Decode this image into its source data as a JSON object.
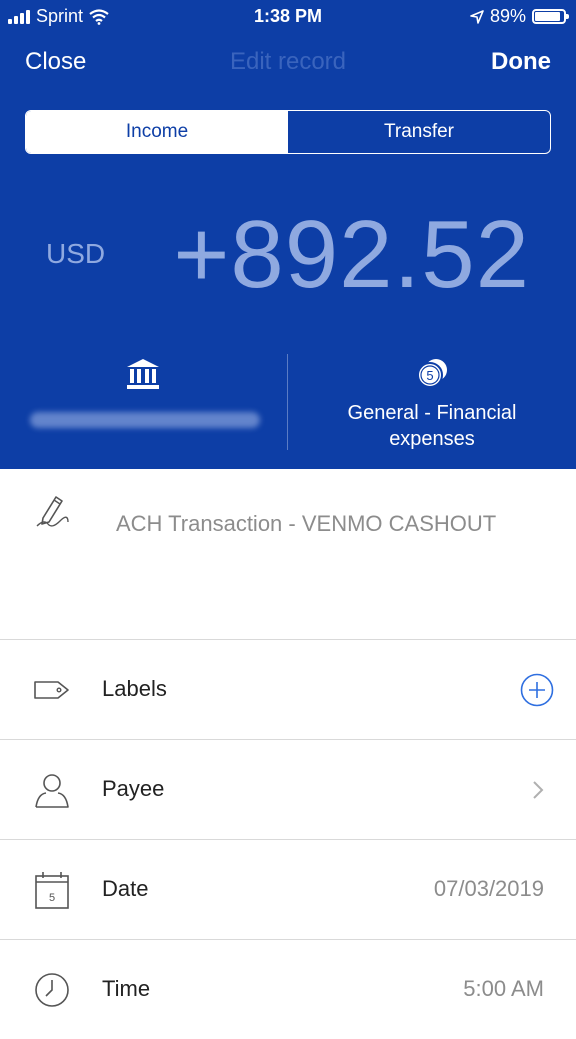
{
  "status_bar": {
    "carrier": "Sprint",
    "time": "1:38 PM",
    "battery": "89%"
  },
  "nav": {
    "close": "Close",
    "title": "Edit record",
    "done": "Done"
  },
  "segments": {
    "income": "Income",
    "transfer": "Transfer"
  },
  "amount": {
    "currency": "USD",
    "value": "+892.52"
  },
  "category": {
    "badge": "5",
    "label_line1": "General - Financial",
    "label_line2": "expenses"
  },
  "note": {
    "text": "ACH Transaction - VENMO CASHOUT"
  },
  "rows": {
    "labels": {
      "label": "Labels"
    },
    "payee": {
      "label": "Payee"
    },
    "date": {
      "label": "Date",
      "value": "07/03/2019",
      "icon_day": "5"
    },
    "time": {
      "label": "Time",
      "value": "5:00 AM"
    }
  },
  "colors": {
    "header_blue": "#0d3ea6",
    "accent": "#2f6fe0",
    "amount_text": "#8fa9e0"
  }
}
